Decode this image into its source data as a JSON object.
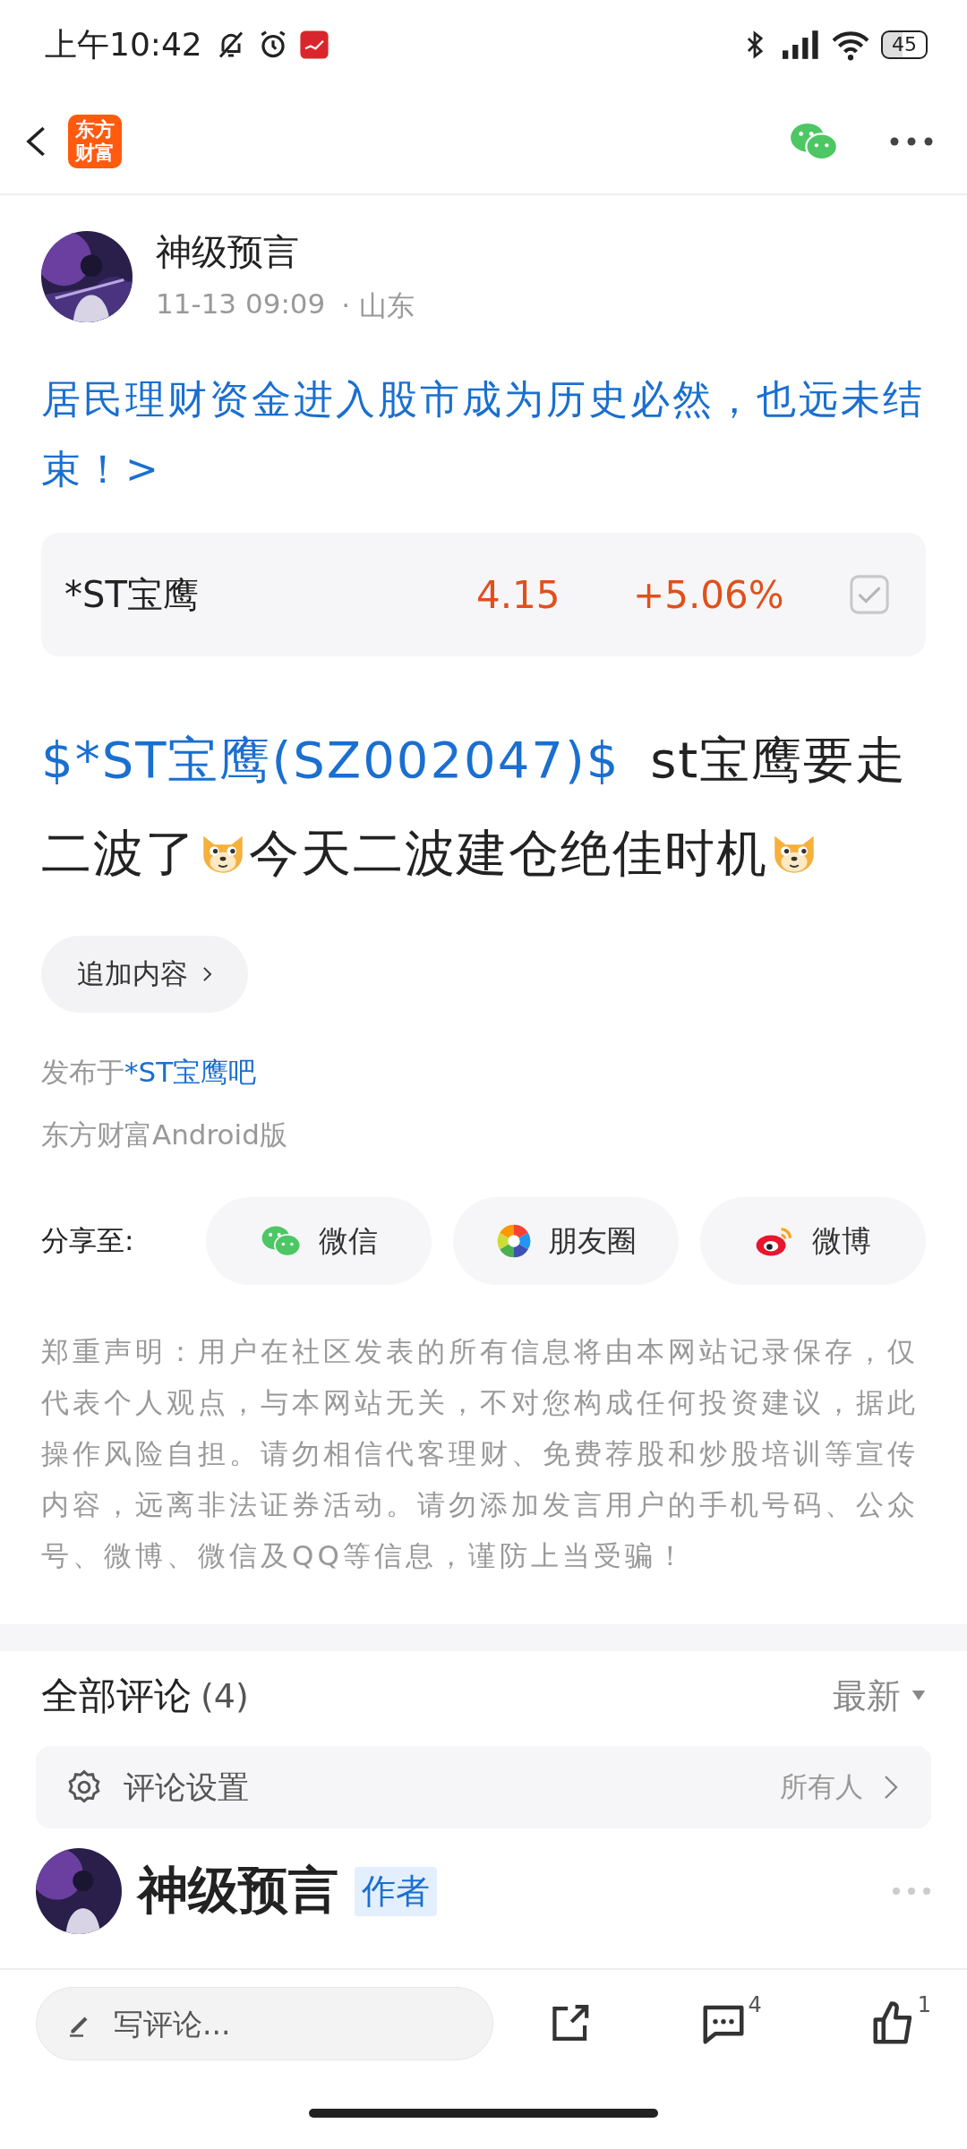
{
  "status_bar": {
    "time": "上午10:42",
    "battery": "45"
  },
  "header": {
    "logo": [
      "东方",
      "财富"
    ]
  },
  "post": {
    "author": "神级预言",
    "time": "11-13 09:09",
    "location": "· 山东",
    "title": "居民理财资金进入股市成为历史必然，也远未结束！>",
    "stock": {
      "name": "*ST宝鹰",
      "price": "4.15",
      "change": "+5.06%",
      "checked": true
    },
    "body": [
      {
        "kind": "link",
        "text": "$*ST宝鹰(SZ002047)$"
      },
      {
        "kind": "text",
        "text": " st宝鹰要走二波了"
      },
      {
        "kind": "emoji"
      },
      {
        "kind": "text",
        "text": "今天二波建仓绝佳时机"
      },
      {
        "kind": "emoji"
      }
    ],
    "add_content": "追加内容",
    "published_in": {
      "prefix": "发布于",
      "forum": "*ST宝鹰吧"
    },
    "source": "东方财富Android版"
  },
  "share": {
    "label": "分享至:",
    "targets": [
      {
        "kind": "wechat",
        "label": "微信"
      },
      {
        "kind": "moments",
        "label": "朋友圈"
      },
      {
        "kind": "weibo",
        "label": "微博"
      }
    ]
  },
  "disclaimer": "郑重声明：用户在社区发表的所有信息将由本网站记录保存，仅代表个人观点，与本网站无关，不对您构成任何投资建议，据此操作风险自担。请勿相信代客理财、免费荐股和炒股培训等宣传内容，远离非法证券活动。请勿添加发言用户的手机号码、公众号、微博、微信及QQ等信息，谨防上当受骗！",
  "comments": {
    "title": "全部评论",
    "count": "(4)",
    "sort": "最新",
    "settings": {
      "label": "评论设置",
      "value": "所有人"
    },
    "items": [
      {
        "author": "神级预言",
        "badge": "作者"
      }
    ]
  },
  "bottom_bar": {
    "placeholder": "写评论...",
    "comment_count": "4",
    "like_count": "1"
  }
}
